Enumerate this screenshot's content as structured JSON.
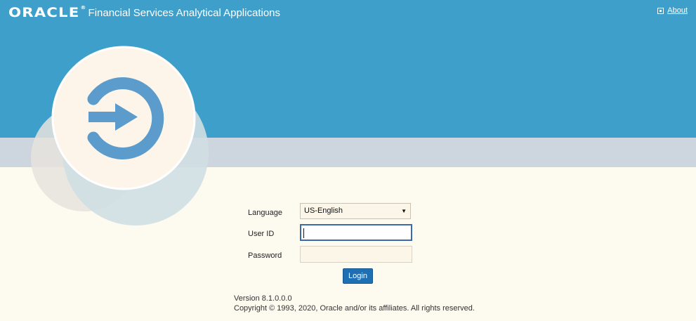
{
  "header": {
    "logo_text": "ORACLE",
    "title": "Financial Services Analytical Applications",
    "about_label": "About"
  },
  "login_form": {
    "language_label": "Language",
    "language_value": "US-English",
    "user_id_label": "User ID",
    "user_id_value": "",
    "password_label": "Password",
    "password_value": "",
    "login_label": "Login"
  },
  "footer": {
    "version": "Version 8.1.0.0.0",
    "copyright": "Copyright © 1993, 2020, Oracle and/or its affiliates. All rights reserved."
  },
  "colors": {
    "header_blue": "#3f9fcb",
    "band_gray": "#cdd6de",
    "page_cream": "#fdfaf0",
    "button_blue": "#1f6fb4",
    "icon_arrow_blue": "#5b9ccc"
  },
  "icons": {
    "about": "info-square-icon",
    "hero": "sign-in-arrow-icon"
  }
}
